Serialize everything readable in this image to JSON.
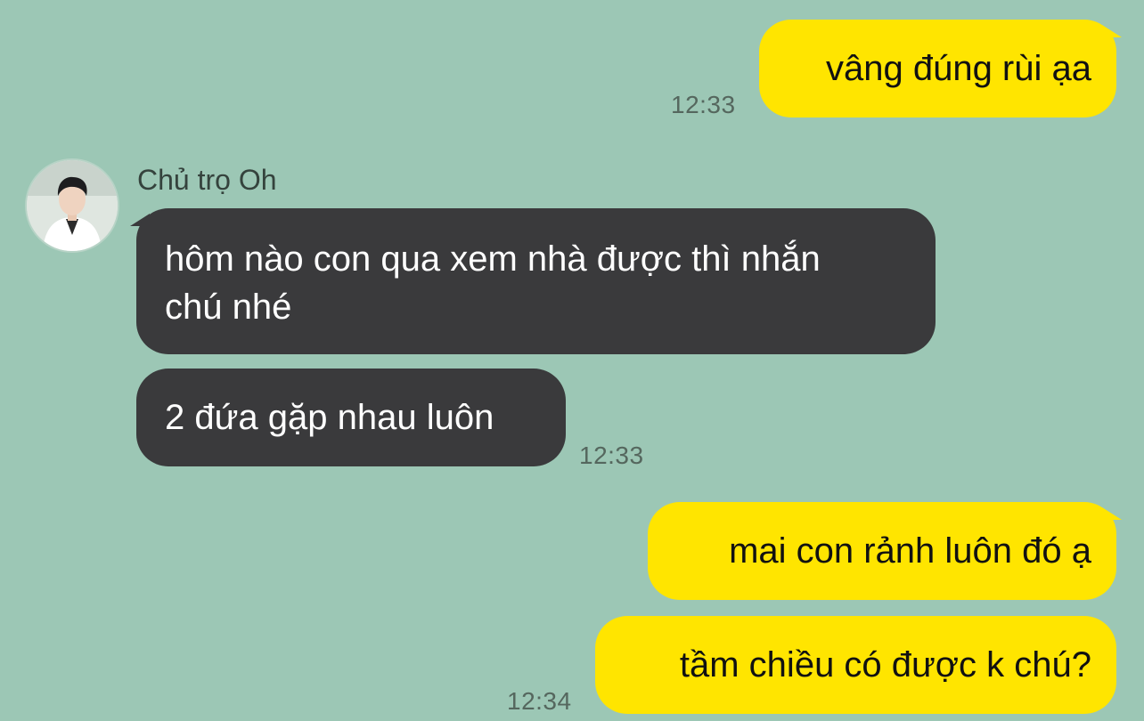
{
  "chat": {
    "contact_name": "Chủ trọ Oh",
    "messages": [
      {
        "text": "vâng đúng rùi ạa",
        "time": "12:33"
      },
      {
        "line1": "hôm nào con qua xem nhà được thì nhắn",
        "line2": "chú nhé"
      },
      {
        "text": "2 đứa gặp nhau luôn",
        "time": "12:33"
      },
      {
        "text": "mai con rảnh luôn đó ạ"
      },
      {
        "text": "tầm chiều có được k chú?",
        "time": "12:34"
      }
    ]
  },
  "colors": {
    "background": "#9cc7b5",
    "outgoing_bubble": "#ffe500",
    "incoming_bubble": "#3a3a3c"
  }
}
